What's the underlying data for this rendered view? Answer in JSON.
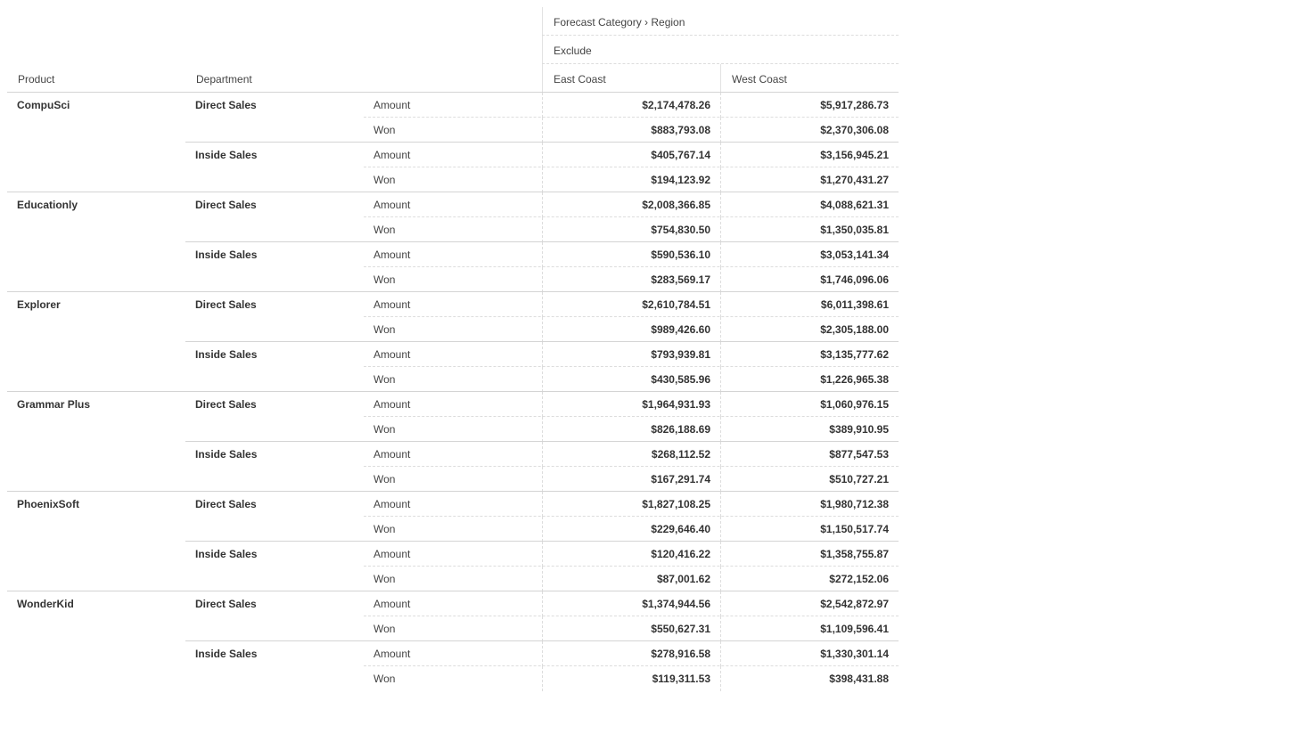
{
  "header": {
    "column_path": "Forecast Category › Region",
    "column_value": "Exclude",
    "row_headers": [
      "Product",
      "Department"
    ],
    "regions": [
      "East Coast",
      "West Coast"
    ]
  },
  "rows": [
    {
      "product": "CompuSci",
      "departments": [
        {
          "name": "Direct Sales",
          "measures": [
            {
              "label": "Amount",
              "east": "$2,174,478.26",
              "west": "$5,917,286.73"
            },
            {
              "label": "Won",
              "east": "$883,793.08",
              "west": "$2,370,306.08"
            }
          ]
        },
        {
          "name": "Inside Sales",
          "measures": [
            {
              "label": "Amount",
              "east": "$405,767.14",
              "west": "$3,156,945.21"
            },
            {
              "label": "Won",
              "east": "$194,123.92",
              "west": "$1,270,431.27"
            }
          ]
        }
      ]
    },
    {
      "product": "Educationly",
      "departments": [
        {
          "name": "Direct Sales",
          "measures": [
            {
              "label": "Amount",
              "east": "$2,008,366.85",
              "west": "$4,088,621.31"
            },
            {
              "label": "Won",
              "east": "$754,830.50",
              "west": "$1,350,035.81"
            }
          ]
        },
        {
          "name": "Inside Sales",
          "measures": [
            {
              "label": "Amount",
              "east": "$590,536.10",
              "west": "$3,053,141.34"
            },
            {
              "label": "Won",
              "east": "$283,569.17",
              "west": "$1,746,096.06"
            }
          ]
        }
      ]
    },
    {
      "product": "Explorer",
      "departments": [
        {
          "name": "Direct Sales",
          "measures": [
            {
              "label": "Amount",
              "east": "$2,610,784.51",
              "west": "$6,011,398.61"
            },
            {
              "label": "Won",
              "east": "$989,426.60",
              "west": "$2,305,188.00"
            }
          ]
        },
        {
          "name": "Inside Sales",
          "measures": [
            {
              "label": "Amount",
              "east": "$793,939.81",
              "west": "$3,135,777.62"
            },
            {
              "label": "Won",
              "east": "$430,585.96",
              "west": "$1,226,965.38"
            }
          ]
        }
      ]
    },
    {
      "product": "Grammar Plus",
      "departments": [
        {
          "name": "Direct Sales",
          "measures": [
            {
              "label": "Amount",
              "east": "$1,964,931.93",
              "west": "$1,060,976.15"
            },
            {
              "label": "Won",
              "east": "$826,188.69",
              "west": "$389,910.95"
            }
          ]
        },
        {
          "name": "Inside Sales",
          "measures": [
            {
              "label": "Amount",
              "east": "$268,112.52",
              "west": "$877,547.53"
            },
            {
              "label": "Won",
              "east": "$167,291.74",
              "west": "$510,727.21"
            }
          ]
        }
      ]
    },
    {
      "product": "PhoenixSoft",
      "departments": [
        {
          "name": "Direct Sales",
          "measures": [
            {
              "label": "Amount",
              "east": "$1,827,108.25",
              "west": "$1,980,712.38"
            },
            {
              "label": "Won",
              "east": "$229,646.40",
              "west": "$1,150,517.74"
            }
          ]
        },
        {
          "name": "Inside Sales",
          "measures": [
            {
              "label": "Amount",
              "east": "$120,416.22",
              "west": "$1,358,755.87"
            },
            {
              "label": "Won",
              "east": "$87,001.62",
              "west": "$272,152.06"
            }
          ]
        }
      ]
    },
    {
      "product": "WonderKid",
      "departments": [
        {
          "name": "Direct Sales",
          "measures": [
            {
              "label": "Amount",
              "east": "$1,374,944.56",
              "west": "$2,542,872.97"
            },
            {
              "label": "Won",
              "east": "$550,627.31",
              "west": "$1,109,596.41"
            }
          ]
        },
        {
          "name": "Inside Sales",
          "measures": [
            {
              "label": "Amount",
              "east": "$278,916.58",
              "west": "$1,330,301.14"
            },
            {
              "label": "Won",
              "east": "$119,311.53",
              "west": "$398,431.88"
            }
          ]
        }
      ]
    }
  ]
}
